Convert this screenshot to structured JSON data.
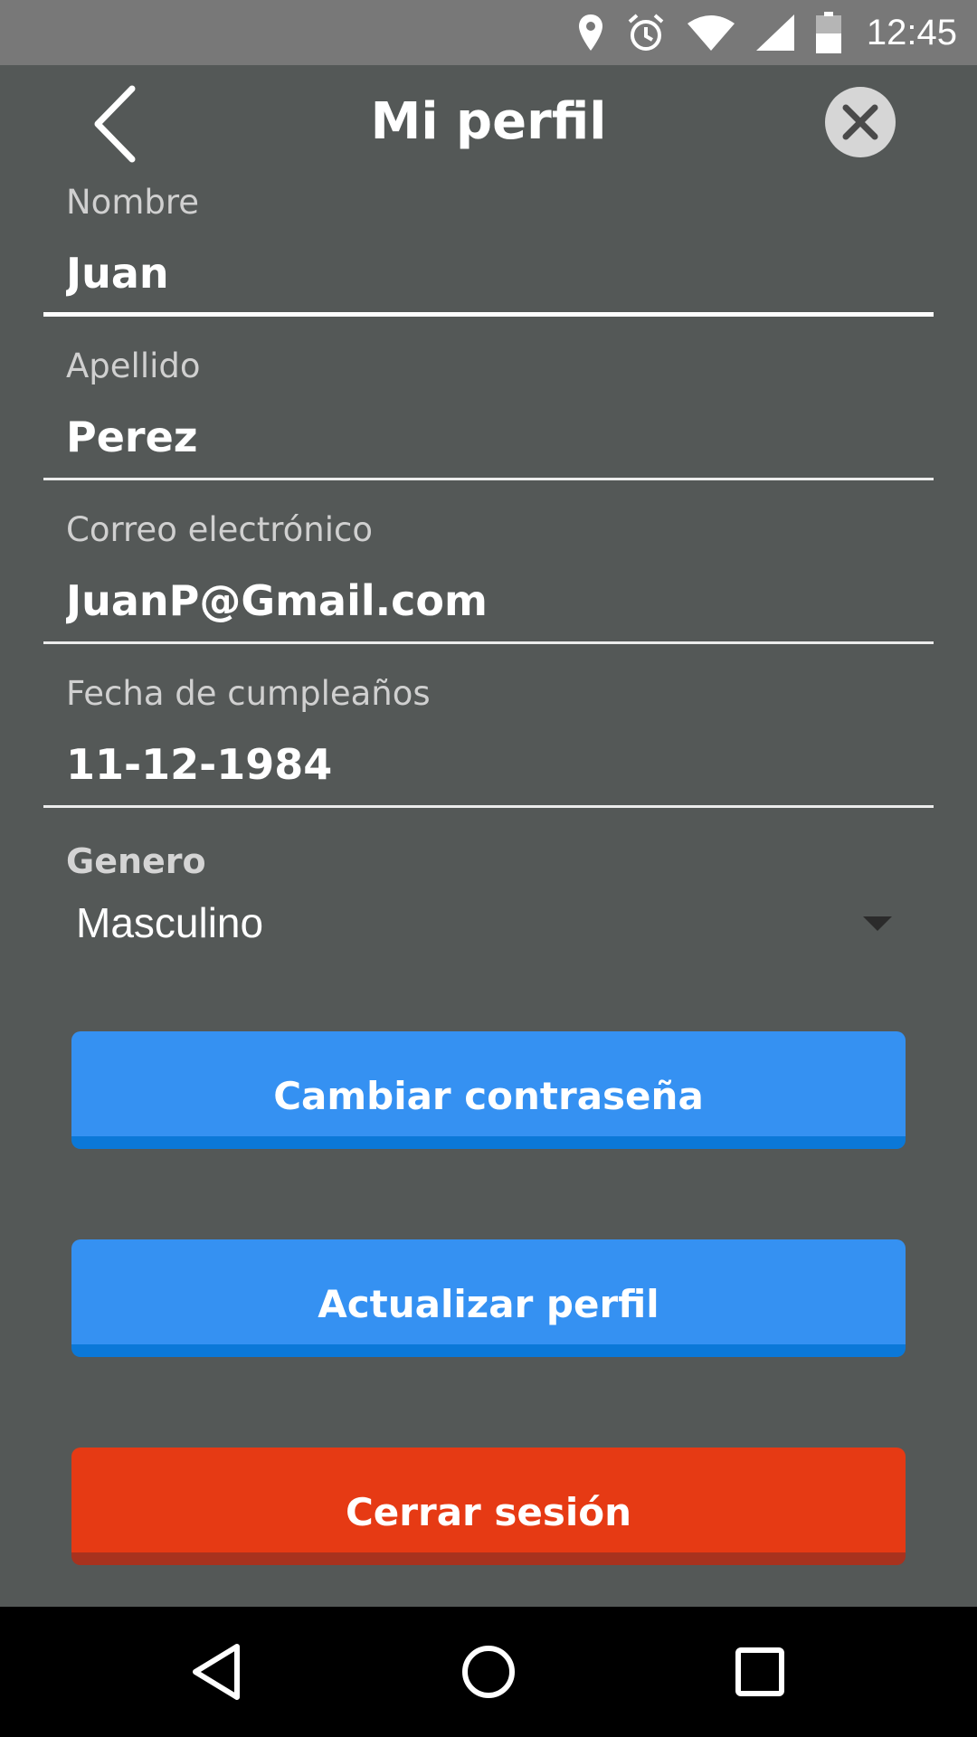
{
  "status_bar": {
    "time": "12:45",
    "icons": [
      "location-icon",
      "alarm-icon",
      "wifi-icon",
      "signal-icon",
      "battery-icon"
    ]
  },
  "app_bar": {
    "title": "Mi perfil",
    "back_icon": "chevron-left-icon",
    "close_icon": "close-icon"
  },
  "form": {
    "nombre": {
      "label": "Nombre",
      "value": "Juan"
    },
    "apellido": {
      "label": "Apellido",
      "value": "Perez"
    },
    "correo": {
      "label": "Correo electrónico",
      "value": "JuanP@Gmail.com"
    },
    "fecha": {
      "label": "Fecha de cumpleaños",
      "value": "11-12-1984"
    },
    "genero": {
      "label": "Genero",
      "value": "Masculino"
    }
  },
  "buttons": {
    "change_password": "Cambiar contraseña",
    "update_profile": "Actualizar perfil",
    "logout": "Cerrar sesión"
  },
  "colors": {
    "background": "#545857",
    "primary": "#3591f2",
    "danger": "#e63a14"
  },
  "nav_bar": {
    "icons": [
      "back-triangle-icon",
      "home-circle-icon",
      "recents-square-icon"
    ]
  }
}
